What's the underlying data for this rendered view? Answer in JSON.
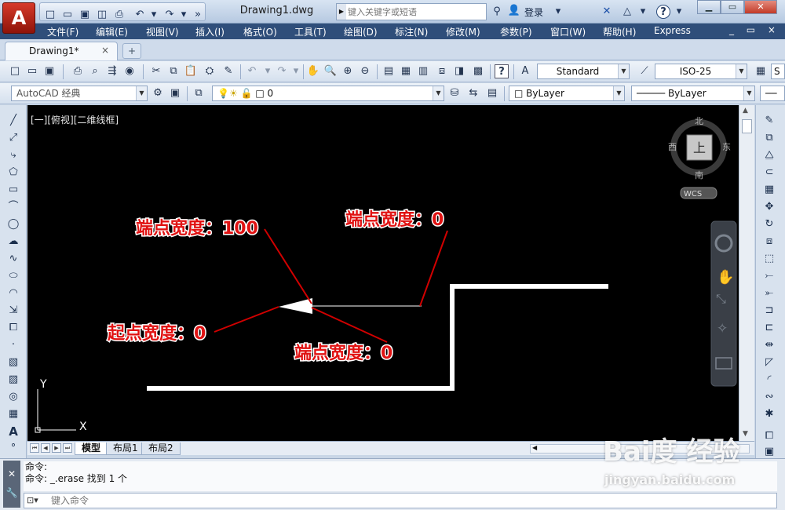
{
  "title_bar": {
    "logo": "A",
    "document_title": "Drawing1.dwg",
    "search_placeholder": "键入关键字或短语",
    "login": "登录",
    "help": "?"
  },
  "menu": {
    "items": [
      "文件(F)",
      "编辑(E)",
      "视图(V)",
      "插入(I)",
      "格式(O)",
      "工具(T)",
      "绘图(D)",
      "标注(N)",
      "修改(M)",
      "参数(P)",
      "窗口(W)",
      "帮助(H)",
      "Express"
    ],
    "doc_controls": "_ ▭ ×"
  },
  "tabs": {
    "drawing_tab": "Drawing1*",
    "close_glyph": "×",
    "new_tab_glyph": "+"
  },
  "toolbar": {
    "text_style": "Standard",
    "dim_style": "ISO-25",
    "workspace": "AutoCAD 经典",
    "layer": "0",
    "color": "ByLayer",
    "linetype": "ByLayer",
    "cut_label": "S"
  },
  "viewport": {
    "label": "[一][俯视][二维线框]"
  },
  "viewcube": {
    "north": "北",
    "south": "南",
    "east": "东",
    "west": "西",
    "face": "上",
    "wcs": "WCS"
  },
  "ucs": {
    "x": "X",
    "y": "Y"
  },
  "annotations": {
    "end_width_100": "端点宽度：100",
    "end_width_0_top": "端点宽度：0",
    "start_width_0": "起点宽度：0",
    "end_width_0_bottom": "端点宽度：0"
  },
  "layout_tabs": [
    "模型",
    "布局1",
    "布局2"
  ],
  "command": {
    "history": [
      "命令:",
      "命令: _.erase 找到 1 个"
    ],
    "input_placeholder": "键入命令"
  },
  "watermark": {
    "main": "Bai度 经验",
    "sub": "jingyan.baidu.com"
  },
  "colors": {
    "canvas": "#000000",
    "menubar": "#2f4e7a",
    "annotation_red": "#e01212",
    "annotation_line": "#d10000",
    "drawing_white": "#ffffff"
  }
}
